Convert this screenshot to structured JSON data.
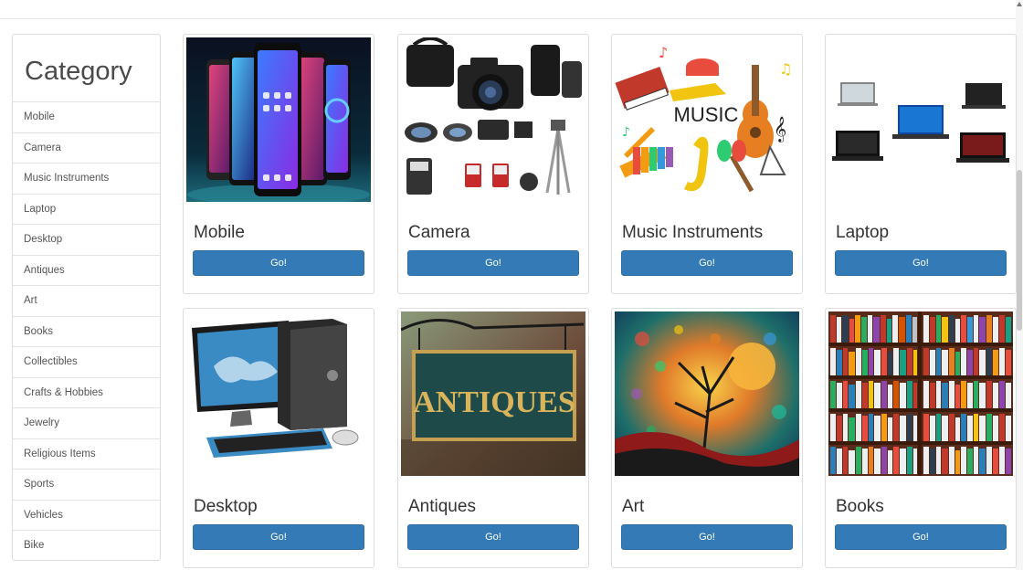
{
  "sidebar": {
    "title": "Category",
    "items": [
      {
        "label": "Mobile"
      },
      {
        "label": "Camera"
      },
      {
        "label": "Music Instruments"
      },
      {
        "label": "Laptop"
      },
      {
        "label": "Desktop"
      },
      {
        "label": "Antiques"
      },
      {
        "label": "Art"
      },
      {
        "label": "Books"
      },
      {
        "label": "Collectibles"
      },
      {
        "label": "Crafts & Hobbies"
      },
      {
        "label": "Jewelry"
      },
      {
        "label": "Religious Items"
      },
      {
        "label": "Sports"
      },
      {
        "label": "Vehicles"
      },
      {
        "label": "Bike"
      }
    ]
  },
  "cards": [
    {
      "title": "Mobile",
      "button": "Go!",
      "image": "smartphones-photo"
    },
    {
      "title": "Camera",
      "button": "Go!",
      "image": "camera-kit-photo"
    },
    {
      "title": "Music Instruments",
      "button": "Go!",
      "image": "music-instruments-illustration",
      "image_text": "MUSIC"
    },
    {
      "title": "Laptop",
      "button": "Go!",
      "image": "laptops-photo"
    },
    {
      "title": "Desktop",
      "button": "Go!",
      "image": "desktop-computer-illustration"
    },
    {
      "title": "Antiques",
      "button": "Go!",
      "image": "antiques-sign-photo",
      "image_text": "ANTIQUES"
    },
    {
      "title": "Art",
      "button": "Go!",
      "image": "abstract-tree-painting"
    },
    {
      "title": "Books",
      "button": "Go!",
      "image": "bookshelf-photo"
    }
  ],
  "colors": {
    "primary_button": "#337ab7",
    "border": "#dddddd",
    "text": "#333333"
  }
}
